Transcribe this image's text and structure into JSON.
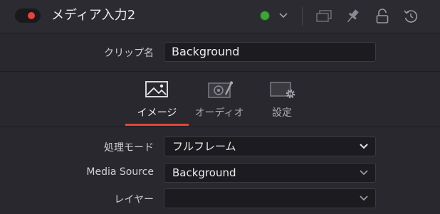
{
  "header": {
    "title": "メディア入力2",
    "toggle_knob_color": "#e5443c",
    "status_color": "#3fa23a",
    "icons": [
      "toggle-switch",
      "status-dot-icon",
      "chevron-down-icon",
      "copy-icon",
      "pin-icon",
      "lock-icon",
      "reset-icon"
    ]
  },
  "clip": {
    "label": "クリップ名",
    "value": "Background"
  },
  "tabs": [
    {
      "label": "イメージ",
      "icon": "image-icon",
      "active": true
    },
    {
      "label": "オーディオ",
      "icon": "audio-icon",
      "active": false
    },
    {
      "label": "設定",
      "icon": "settings-icon",
      "active": false
    }
  ],
  "fields": {
    "processing_mode": {
      "label": "処理モード",
      "value": "フルフレーム"
    },
    "media_source": {
      "label": "Media Source",
      "value": "Background"
    },
    "layer": {
      "label": "レイヤー",
      "value": ""
    }
  },
  "accent_color": "#e5443c"
}
